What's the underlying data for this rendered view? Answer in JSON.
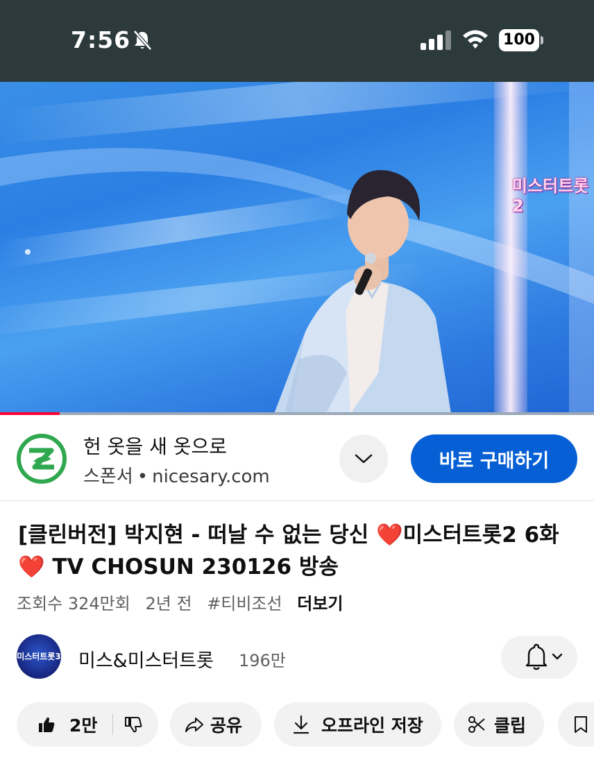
{
  "status_bar": {
    "time": "7:56",
    "battery": "100"
  },
  "video": {
    "channel_logo_text": "미스터트롯2",
    "progress_fraction": 0.1
  },
  "ad": {
    "title": "헌 옷을 새 옷으로",
    "sponsor_label": "스폰서",
    "separator": "•",
    "domain": "nicesary.com",
    "cta_label": "바로 구매하기",
    "accent_color": "#065fd4"
  },
  "video_info": {
    "title": "[클린버전] 박지현 - 떠날 수 없는 당신 ❤️미스터트롯2 6화❤️ TV CHOSUN 230126 방송",
    "views": "조회수 324만회",
    "age": "2년 전",
    "hashtag": "#티비조선",
    "more_label": "더보기"
  },
  "channel": {
    "avatar_text": "미스터트롯3",
    "name": "미스&미스터트롯",
    "subscribers": "196만"
  },
  "actions": {
    "like_count": "2만",
    "share_label": "공유",
    "offline_label": "오프라인 저장",
    "clip_label": "클립"
  }
}
